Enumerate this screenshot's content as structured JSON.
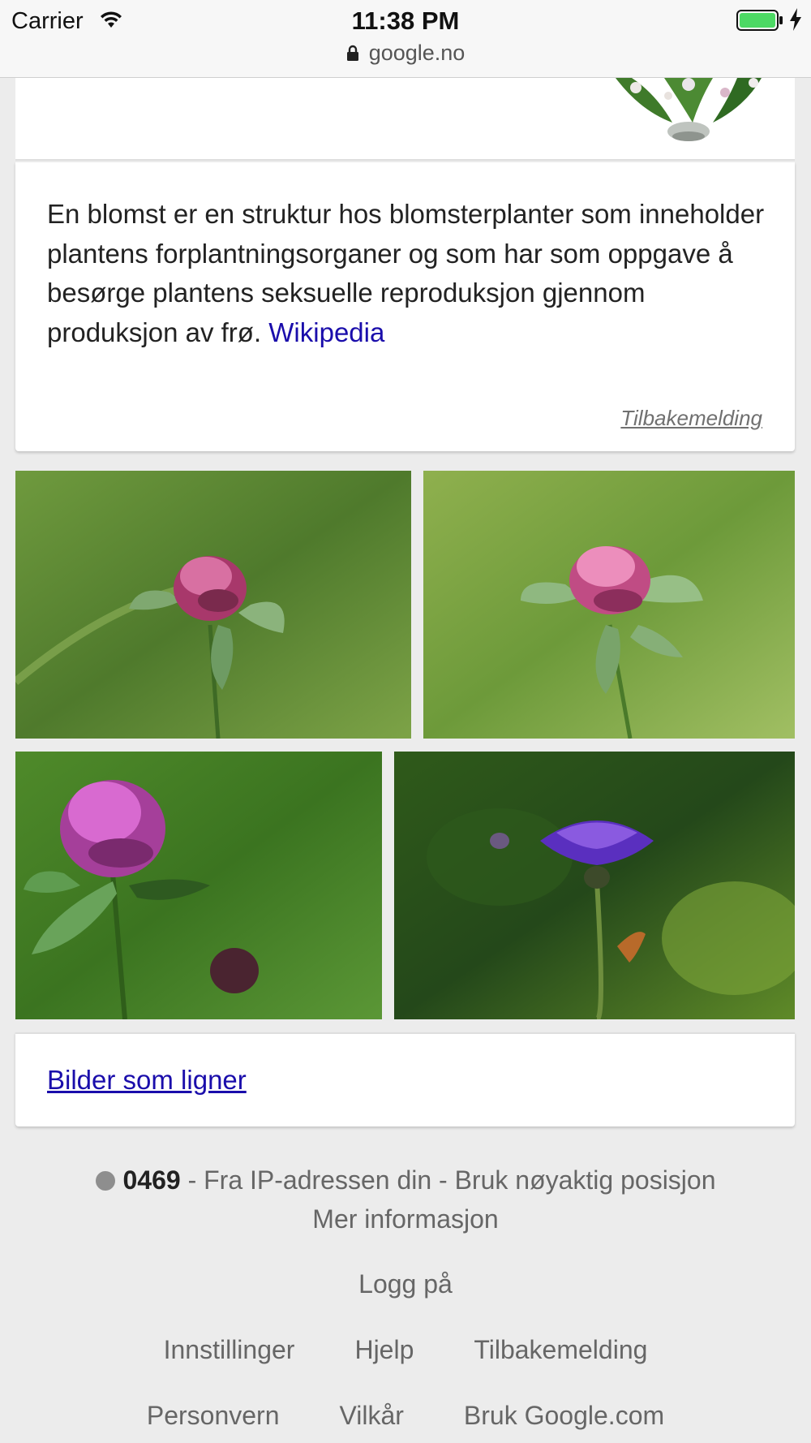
{
  "status_bar": {
    "carrier": "Carrier",
    "time": "11:38 PM",
    "url": "google.no",
    "battery_color": "#4cd964"
  },
  "knowledge_panel": {
    "description": "En blomst er en struktur hos blomsterplanter som inneholder plantens forplantningsorganer og som har som oppgave å besørge plantens seksuelle reproduksjon gjennom produksjon av frø.",
    "source_link": "Wikipedia",
    "feedback": "Tilbakemelding"
  },
  "images": [
    {
      "icon": "red-clover-image"
    },
    {
      "icon": "red-clover-image"
    },
    {
      "icon": "purple-clover-image"
    },
    {
      "icon": "cornflower-image"
    }
  ],
  "similar_images_link": "Bilder som ligner",
  "footer": {
    "postal_code": "0469",
    "location_text": " - Fra IP-adressen din - Bruk nøyaktig posisjon",
    "more_info": "Mer informasjon",
    "login": "Logg på",
    "links_row1": [
      "Innstillinger",
      "Hjelp",
      "Tilbakemelding"
    ],
    "links_row2": [
      "Personvern",
      "Vilkår",
      "Bruk Google.com"
    ]
  },
  "colors": {
    "link": "#1a0dab",
    "background": "#ececec",
    "card": "#ffffff"
  }
}
